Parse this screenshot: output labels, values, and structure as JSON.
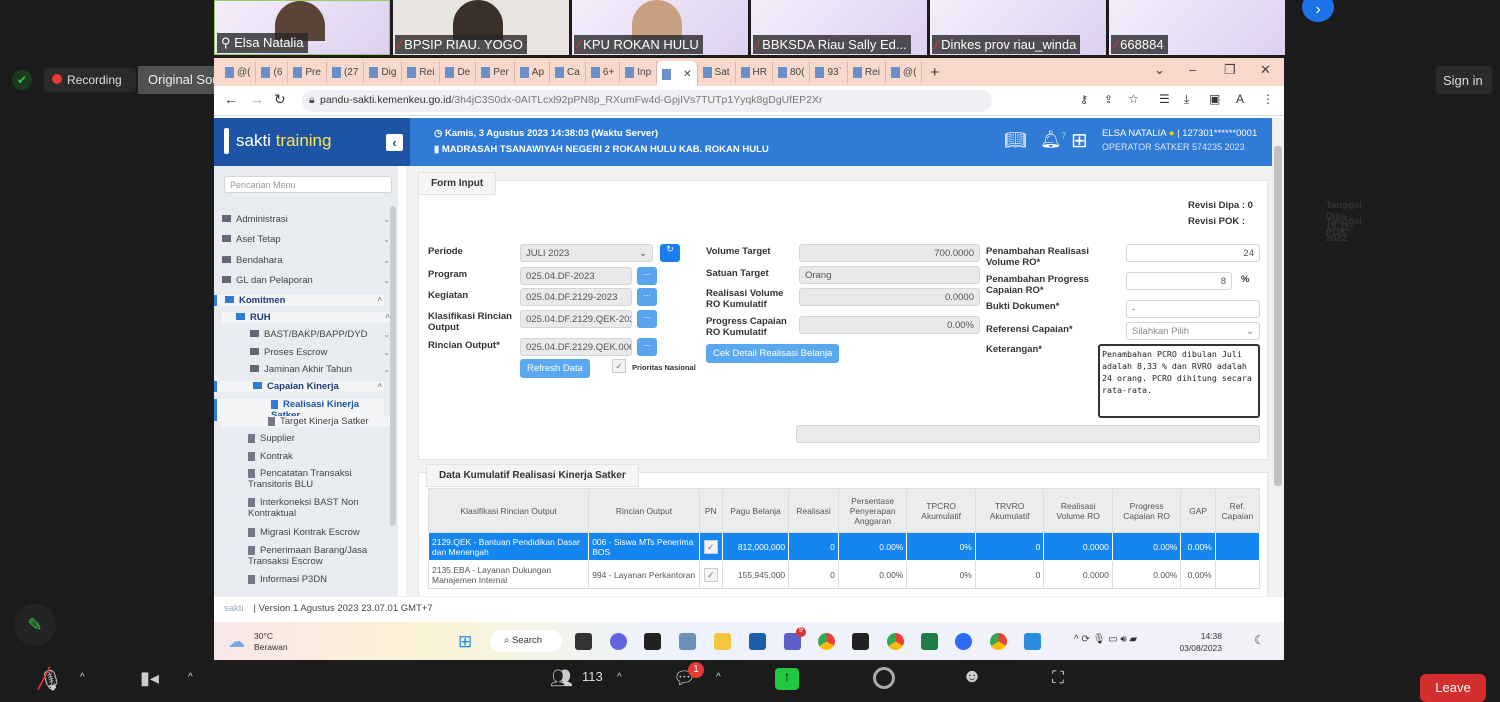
{
  "participants": [
    "Elsa Natalia",
    "BPSIP RIAU. YOGO",
    "KPU ROKAN HULU",
    "BBKSDA Riau Sally Ed...",
    "Dinkes prov riau_winda",
    "668884"
  ],
  "zoom": {
    "recording": "Recording",
    "tooltip": "Original Sound for Musicians: Off",
    "sign_in": "Sign in",
    "participants_count": "113",
    "chat_badge": "1",
    "leave": "Leave"
  },
  "browser": {
    "tabs": [
      "@(",
      "(6",
      "Pre",
      "(27",
      "Dig",
      "Rei",
      "De",
      "Per",
      "Ap",
      "Ca",
      "6+",
      "Inp",
      "",
      "Sat",
      "HR",
      "80(",
      "93`",
      "Rei",
      "@("
    ],
    "url_domain": "pandu-sakti.kemenkeu.go.id",
    "url_path": "/3h4jC3S0dx-0AITLcxl92pPN8p_RXumFw4d-GpjIVs7TUTp1Yyqk8gDgUfEP2Xr"
  },
  "header": {
    "logo_a": "sakti",
    "logo_b": "training",
    "datetime": "Kamis, 3 Agustus 2023 14:38:03 (Waktu Server)",
    "satker": "MADRASAH TSANAWIYAH NEGERI 2 ROKAN HULU KAB. ROKAN HULU",
    "notif_count": "7",
    "user": "ELSA NATALIA",
    "user_id": "| 127301******0001",
    "role": "OPERATOR SATKER 574235 2023"
  },
  "sidebar": {
    "search_placeholder": "Pencarian Menu",
    "items": [
      "Administrasi",
      "Aset Tetap",
      "Bendahara",
      "GL dan Pelaporan",
      "Komitmen",
      "RUH",
      "BAST/BAKP/BAPP/DYD",
      "Proses Escrow",
      "Jaminan Akhir Tahun",
      "Capaian Kinerja",
      "Realisasi Kinerja Satker",
      "Target Kinerja Satker",
      "Supplier",
      "Kontrak",
      "Pencatatan Transaksi Transitoris BLU",
      "Interkoneksi BAST Non Kontraktual",
      "Migrasi Kontrak Escrow",
      "Penerimaan Barang/Jasa Transaksi Escrow",
      "Informasi P3DN"
    ]
  },
  "form": {
    "title": "Form Input",
    "revisi_dipa": "Revisi Dipa : 0",
    "revisi_pok": "Revisi POK :",
    "tanggal_dipa": "Tanggal Dipa : 18-11-2022",
    "tanggal_pok": "Tanggal POK :",
    "periode_label": "Periode",
    "periode": "JULI 2023",
    "program_label": "Program",
    "program": "025.04.DF-2023",
    "kegiatan_label": "Kegiatan",
    "kegiatan": "025.04.DF.2129-2023",
    "kro_label": "Klasifikasi Rincian Output",
    "kro": "025.04.DF.2129.QEK-202",
    "ro_label": "Rincian Output*",
    "ro": "025.04.DF.2129.QEK.006",
    "dots": "...",
    "refresh": "Refresh Data",
    "prioritas": "Prioritas Nasional",
    "vol_target_label": "Volume Target",
    "vol_target": "700.0000",
    "satuan_label": "Satuan Target",
    "satuan": "Orang",
    "rvro_label": "Realisasi Volume RO Kumulatif",
    "rvro": "0.0000",
    "pcro_label": "Progress Capaian RO Kumulatif",
    "pcro": "0.00%",
    "cek": "Cek Detail Realisasi Belanja",
    "pen_vol_label": "Penambahan Realisasi Volume RO*",
    "pen_vol": "24",
    "pen_prog_label": "Penambahan Progress Capaian RO*",
    "pen_prog": "8",
    "pct": "%",
    "bukti_label": "Bukti Dokumen*",
    "bukti": "-",
    "ref_label": "Referensi Capaian*",
    "ref": "Silahkan Pilih",
    "ket_label": "Keterangan*",
    "ket": "Penambahan PCRO dibulan Juli adalah 8,33 % dan RVRO adalah 24 orang. PCRO dihitung secara rata-rata."
  },
  "table": {
    "title": "Data Kumulatif Realisasi Kinerja Satker",
    "headers": [
      "Klasifikasi Rincian Output",
      "Rincian Output",
      "PN",
      "Pagu Belanja",
      "Realisasi",
      "Persentase Penyerapan Anggaran",
      "TPCRO Akumulatif",
      "TRVRO Akumulatif",
      "Realisasi Volume RO",
      "Progress Capaian RO",
      "GAP",
      "Ref. Capaian"
    ],
    "rows": [
      [
        "2129.QEK - Bantuan Pendidikan Dasar dan Menengah",
        "006 - Siswa MTs Penerima BOS",
        "✓",
        "812,000,000",
        "0",
        "0.00%",
        "0%",
        "0",
        "0.0000",
        "0.00%",
        "0.00%",
        ""
      ],
      [
        "2135.EBA - Layanan Dukungan Manajemen Internal",
        "994 - Layanan Perkantoran",
        "✓",
        "155,945,000",
        "0",
        "0.00%",
        "0%",
        "0",
        "0.0000",
        "0.00%",
        "0.00%",
        ""
      ]
    ]
  },
  "footer": {
    "logo": "sakti",
    "version": "Version 1 Agustus 2023 23.07.01 GMT+7"
  },
  "taskbar": {
    "temp": "30°C",
    "weather": "Berawan",
    "search": "Search",
    "time": "14:38",
    "date": "03/08/2023",
    "teams_badge": "9"
  }
}
